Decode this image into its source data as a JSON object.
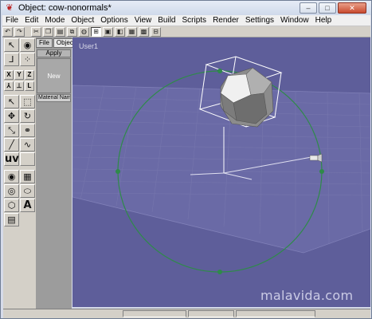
{
  "window": {
    "title": "Object: cow-nonormals*",
    "controls": [
      "–",
      "□",
      "✕"
    ]
  },
  "menu": [
    "File",
    "Edit",
    "Mode",
    "Object",
    "Options",
    "View",
    "Build",
    "Scripts",
    "Render",
    "Settings",
    "Window",
    "Help"
  ],
  "side_panel": {
    "tabs": [
      "File",
      "Object"
    ],
    "apply_label": "Apply",
    "new_label": "New",
    "material_name_label": "Material Name"
  },
  "viewport": {
    "label": "User1",
    "background_color": "#5e5e9a",
    "grid_color": "#7a7ab0",
    "circle_color": "#2f8a4a"
  },
  "watermark": "malavida.com",
  "palette": {
    "axis_buttons": [
      "X",
      "Y",
      "Z"
    ],
    "uv_label": "uv",
    "text_label": "A"
  }
}
